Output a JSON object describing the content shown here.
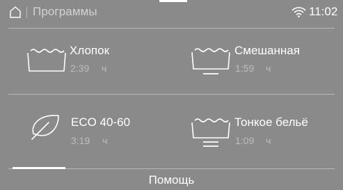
{
  "statusbar": {
    "title": "Программы",
    "time": "11:02"
  },
  "programs": [
    {
      "name": "Хлопок",
      "duration": "2:39",
      "unit": "ч",
      "icon": "basin-icon"
    },
    {
      "name": "Смешанная",
      "duration": "1:59",
      "unit": "ч",
      "icon": "basin-line-icon"
    },
    {
      "name": "ECO 40-60",
      "duration": "3:19",
      "unit": "ч",
      "icon": "leaf-icon"
    },
    {
      "name": "Тонкое бельё",
      "duration": "1:09",
      "unit": "ч",
      "icon": "basin-double-line-icon"
    }
  ],
  "footer": {
    "help_label": "Помощь"
  },
  "colors": {
    "background": "#8a8a8a",
    "divider": "#b8b8b8",
    "text": "#ffffff",
    "muted": "#bdbdbd"
  }
}
